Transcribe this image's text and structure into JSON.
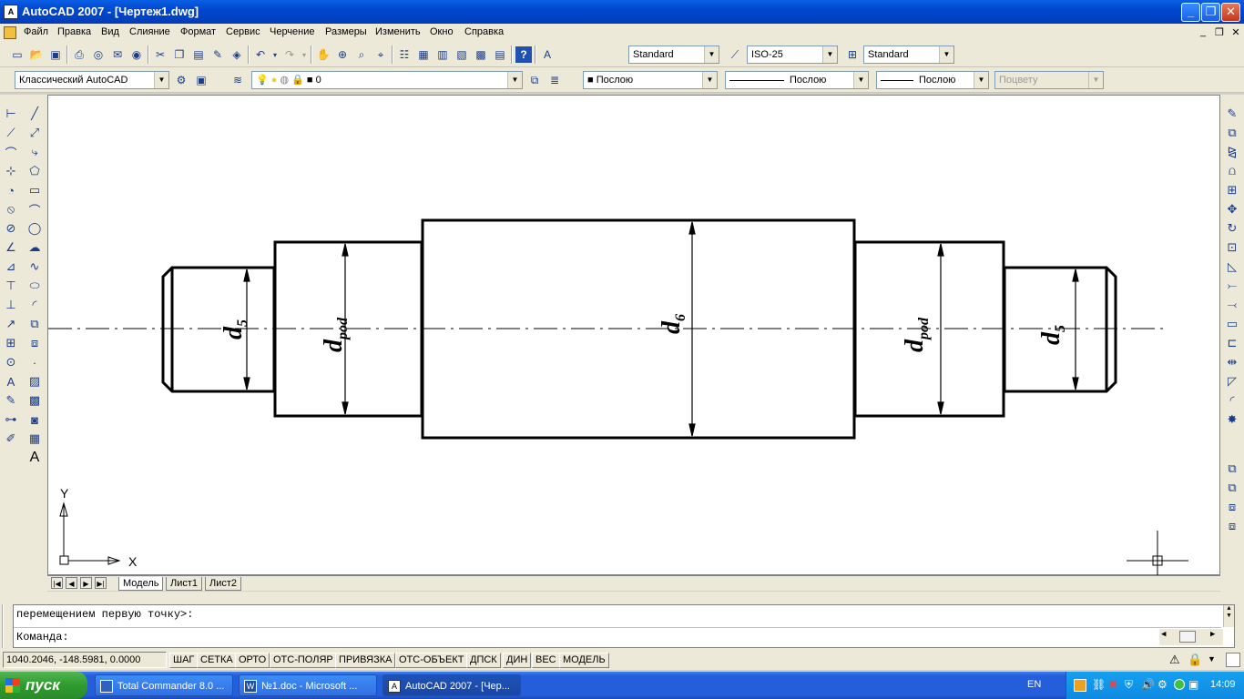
{
  "window": {
    "title": "AutoCAD 2007 - [Чертеж1.dwg]",
    "min": "_",
    "max": "❐",
    "close": "✕"
  },
  "menu": [
    "Файл",
    "Правка",
    "Вид",
    "Слияние",
    "Формат",
    "Сервис",
    "Черчение",
    "Размеры",
    "Изменить",
    "Окно",
    "Справка"
  ],
  "styles": {
    "text_style": "Standard",
    "dim_style": "ISO-25",
    "table_style": "Standard"
  },
  "workspace": "Классический AutoCAD",
  "layer": "0",
  "properties": {
    "color": "Послою",
    "linetype": "Послою",
    "lineweight": "Послою",
    "plotstyle": "Поцвету"
  },
  "drawing": {
    "dims": [
      {
        "main": "d",
        "sub": "5"
      },
      {
        "main": "d",
        "sub": "pod"
      },
      {
        "main": "d",
        "sub": "6"
      },
      {
        "main": "d",
        "sub": "pod"
      },
      {
        "main": "d",
        "sub": "5"
      }
    ],
    "ucs": {
      "x": "X",
      "y": "Y"
    }
  },
  "tabs": [
    "Модель",
    "Лист1",
    "Лист2"
  ],
  "command": {
    "history": "перемещением первую точку>:",
    "prompt": "Команда:"
  },
  "status": {
    "coords": "1040.2046, -148.5981, 0.0000",
    "buttons": [
      "ШАГ",
      "СЕТКА",
      "ОРТО",
      "ОТС-ПОЛЯР",
      "ПРИВЯЗКА",
      "ОТС-ОБЪЕКТ",
      "ДПСК",
      "ДИН",
      "ВЕС",
      "МОДЕЛЬ"
    ]
  },
  "taskbar": {
    "start": "пуск",
    "tasks": [
      "Total Commander 8.0 ...",
      "№1.doc - Microsoft ...",
      "AutoCAD 2007 - [Чер..."
    ],
    "lang": "EN",
    "clock": "14:09"
  }
}
